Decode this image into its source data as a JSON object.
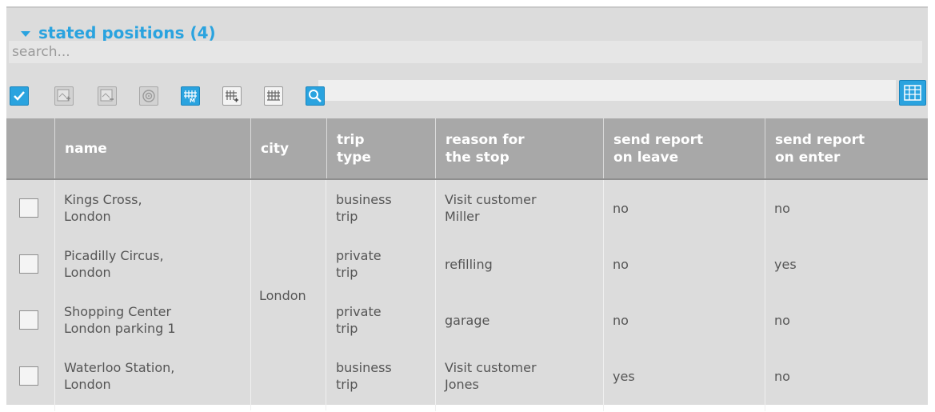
{
  "header": {
    "title": "stated positions (4)",
    "toggle_icon": "triangle-down-icon"
  },
  "search": {
    "placeholder": "search..."
  },
  "toolbar": {
    "buttons": [
      {
        "name": "check-all",
        "icon": "checkmark-icon"
      },
      {
        "name": "add-position",
        "icon": "map-add-icon"
      },
      {
        "name": "remove-position",
        "icon": "map-remove-icon"
      },
      {
        "name": "target",
        "icon": "target-icon"
      },
      {
        "name": "mark-map",
        "icon": "columns-m-icon"
      },
      {
        "name": "columns-add",
        "icon": "columns-plus-icon"
      },
      {
        "name": "columns",
        "icon": "columns-icon"
      },
      {
        "name": "search",
        "icon": "search-icon"
      },
      {
        "name": "grid-view",
        "icon": "grid-icon"
      }
    ]
  },
  "table": {
    "columns": {
      "name": "name",
      "city": "city",
      "trip_type_1": "trip",
      "trip_type_2": "type",
      "reason_1": "reason for",
      "reason_2": "the stop",
      "leave_1": "send report",
      "leave_2": "on leave",
      "enter_1": "send report",
      "enter_2": "on enter"
    },
    "city_merged": "London",
    "rows": [
      {
        "name_1": "Kings Cross,",
        "name_2": "London",
        "trip_1": "business",
        "trip_2": "trip",
        "reason_1": "Visit customer",
        "reason_2": "Miller",
        "leave": "no",
        "enter": "no"
      },
      {
        "name_1": "Picadilly Circus,",
        "name_2": "London",
        "trip_1": "private",
        "trip_2": "trip",
        "reason_1": "refilling",
        "reason_2": "",
        "leave": "no",
        "enter": "yes"
      },
      {
        "name_1": "Shopping Center",
        "name_2": "London parking 1",
        "trip_1": "private",
        "trip_2": "trip",
        "reason_1": "garage",
        "reason_2": "",
        "leave": "no",
        "enter": "no"
      },
      {
        "name_1": "Waterloo Station,",
        "name_2": "London",
        "trip_1": "business",
        "trip_2": "trip",
        "reason_1": "Visit customer",
        "reason_2": "Jones",
        "leave": "yes",
        "enter": "no"
      }
    ]
  },
  "colors": {
    "accent": "#2aa3df",
    "header_bg": "#a8a8a8",
    "panel_bg": "#dcdcdc",
    "text": "#555555"
  }
}
